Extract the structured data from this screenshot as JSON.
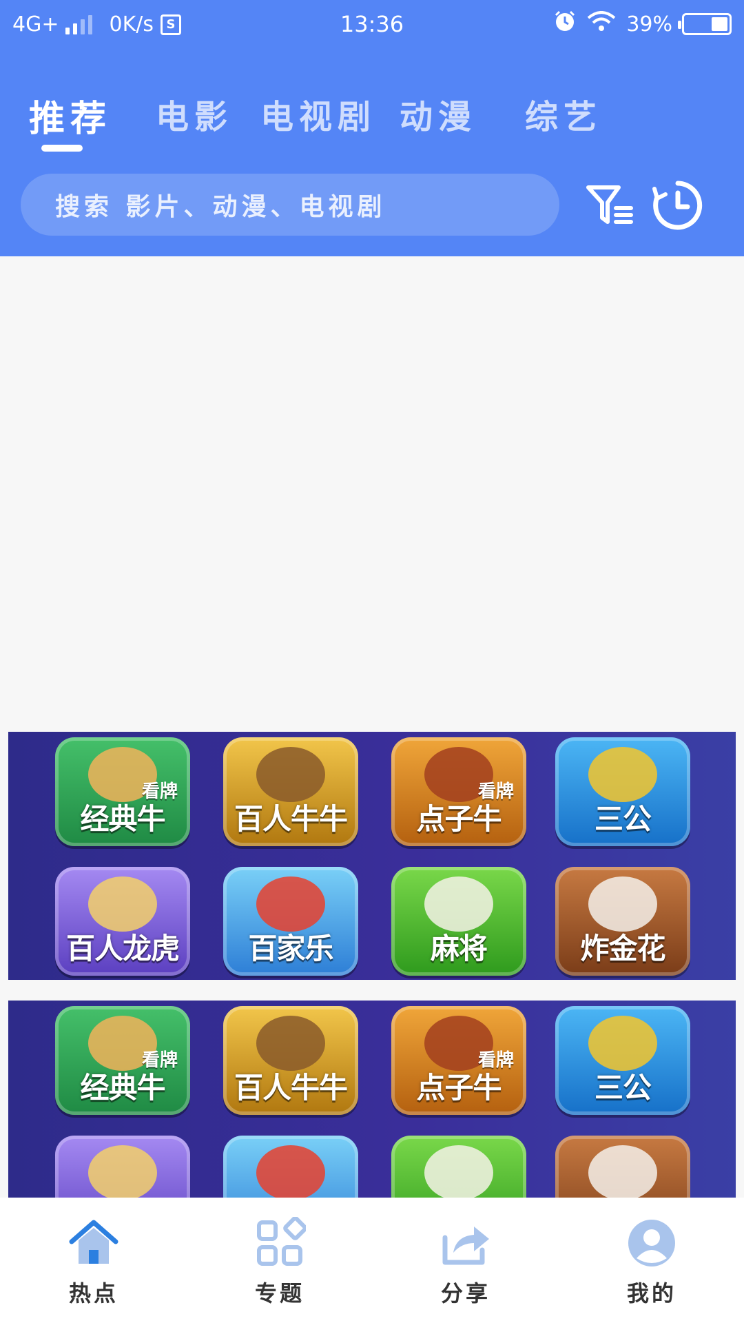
{
  "status_bar": {
    "network": "4G+",
    "speed": "0K/s",
    "sim_badge": "S",
    "time": "13:36",
    "battery": "39%",
    "battery_level": 0.39
  },
  "tabs": [
    {
      "label": "推荐",
      "active": true
    },
    {
      "label": "电影",
      "active": false
    },
    {
      "label": "电视剧",
      "active": false
    },
    {
      "label": "动漫",
      "active": false
    },
    {
      "label": "综艺",
      "active": false
    }
  ],
  "search": {
    "placeholder": "搜索 影片、动漫、电视剧"
  },
  "header_icons": [
    "filter-icon",
    "history-clock-icon"
  ],
  "banner": {
    "tiles": [
      {
        "label": "经典牛",
        "sub": "看牌",
        "color": "green"
      },
      {
        "label": "百人牛牛",
        "sub": "",
        "color": "gold"
      },
      {
        "label": "点子牛",
        "sub": "看牌",
        "color": "orange"
      },
      {
        "label": "三公",
        "sub": "",
        "color": "blue"
      },
      {
        "label": "百人龙虎",
        "sub": "",
        "color": "purple"
      },
      {
        "label": "百家乐",
        "sub": "",
        "color": "lblue"
      },
      {
        "label": "麻将",
        "sub": "",
        "color": "lgreen"
      },
      {
        "label": "炸金花",
        "sub": "",
        "color": "brown"
      }
    ]
  },
  "bottom_nav": [
    {
      "label": "热点",
      "icon": "home-icon",
      "active": true
    },
    {
      "label": "专题",
      "icon": "grid-icon",
      "active": false
    },
    {
      "label": "分享",
      "icon": "share-icon",
      "active": false
    },
    {
      "label": "我的",
      "icon": "user-icon",
      "active": false
    }
  ],
  "colors": {
    "primary": "#5485f6",
    "nav_active": "#2b7fe0",
    "nav_inactive": "#a9c4ec"
  }
}
